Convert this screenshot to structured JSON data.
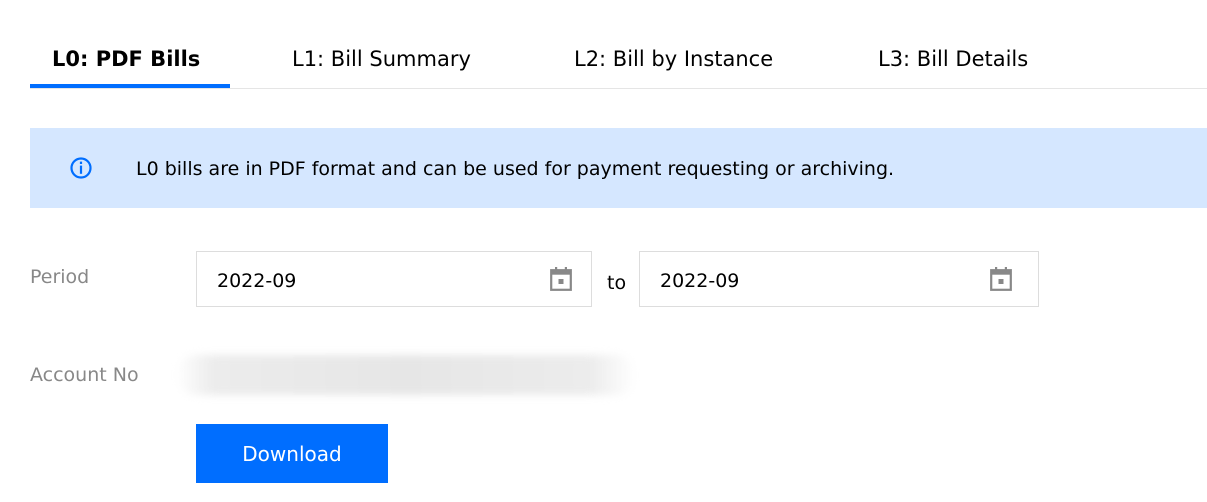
{
  "tabs": [
    {
      "label": "L0: PDF Bills",
      "active": true
    },
    {
      "label": "L1: Bill Summary",
      "active": false
    },
    {
      "label": "L2: Bill by Instance",
      "active": false
    },
    {
      "label": "L3: Bill Details",
      "active": false
    }
  ],
  "banner": {
    "icon": "info-icon",
    "text": "L0 bills are in PDF format and can be used for payment requesting or archiving."
  },
  "period": {
    "label": "Period",
    "start_value": "2022-09",
    "separator": "to",
    "end_value": "2022-09",
    "icon": "calendar-icon"
  },
  "account": {
    "label": "Account No",
    "value_redacted": true
  },
  "actions": {
    "download_label": "Download"
  },
  "colors": {
    "accent": "#006eff",
    "banner_bg": "#d5e7ff",
    "label_gray": "#888888"
  }
}
